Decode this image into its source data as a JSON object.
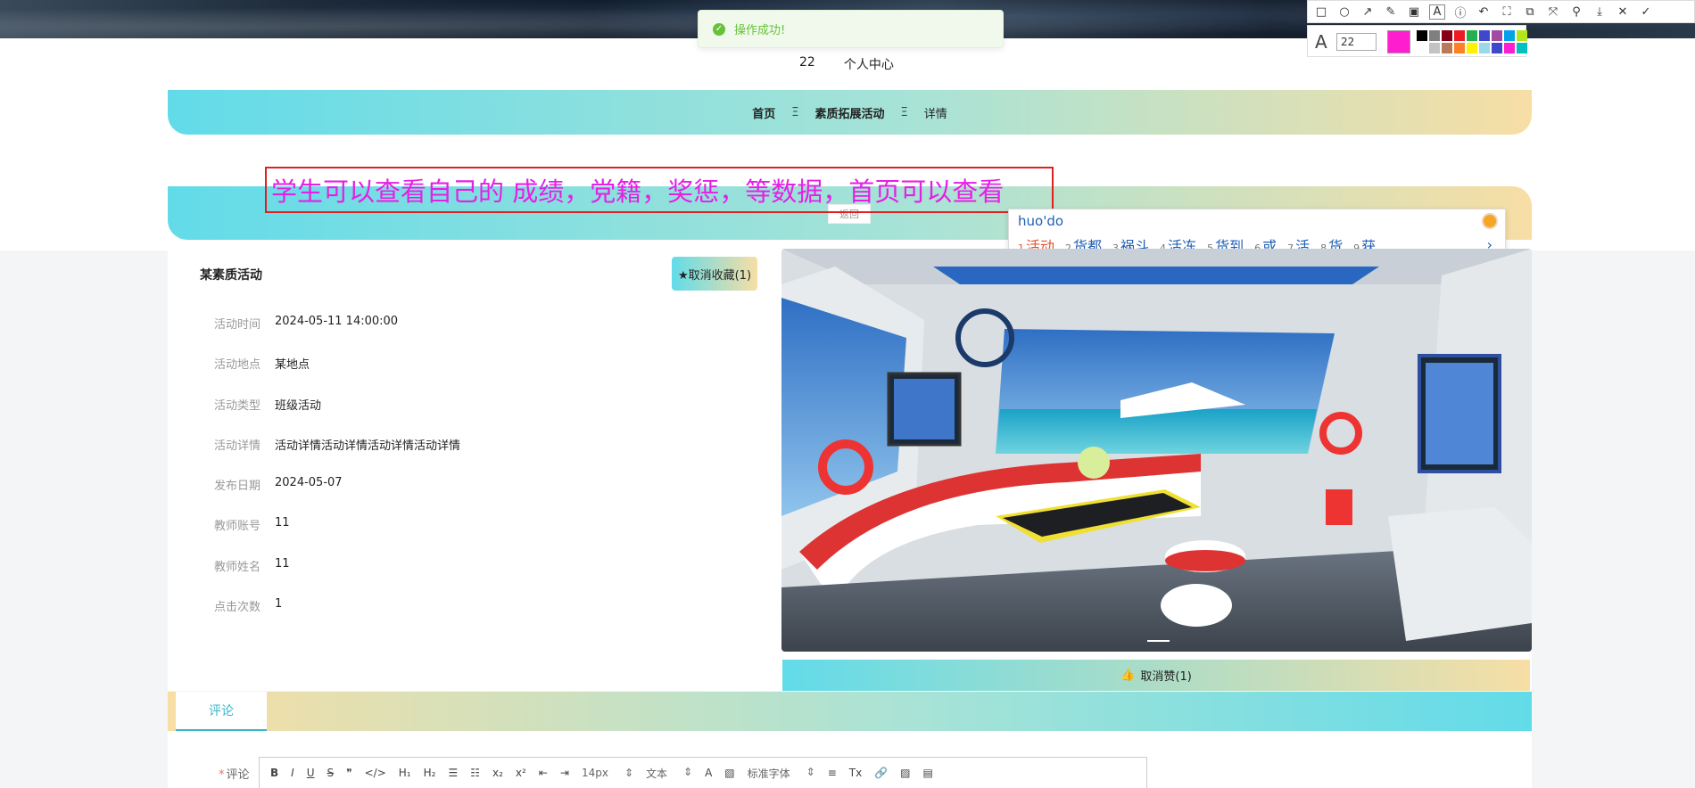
{
  "toast": {
    "message": "操作成功!"
  },
  "header": {
    "user": "22",
    "profile_link": "个人中心"
  },
  "breadcrumb": {
    "home": "首页",
    "sep": "Ξ",
    "section": "素质拓展活动",
    "current": "详情"
  },
  "back_button": {
    "label": "返回"
  },
  "annotation": {
    "text": "学生可以查看自己的 成绩，党籍，奖惩，等数据，首页可以查看"
  },
  "ime": {
    "pinyin": "huo'do",
    "candidates": [
      {
        "n": "1",
        "text": "活动"
      },
      {
        "n": "2",
        "text": "货都"
      },
      {
        "n": "3",
        "text": "祸斗"
      },
      {
        "n": "4",
        "text": "活冻"
      },
      {
        "n": "5",
        "text": "货到"
      },
      {
        "n": "6",
        "text": "或"
      },
      {
        "n": "7",
        "text": "活"
      },
      {
        "n": "8",
        "text": "货"
      },
      {
        "n": "9",
        "text": "获"
      }
    ],
    "next": "›"
  },
  "screenshot_tool": {
    "font_size": "22",
    "current_color": "#ff1dd0",
    "palette": [
      "#000000",
      "#7f7f7f",
      "#880015",
      "#ed1c24",
      "#22b14c",
      "#3f48cc",
      "#a349a4",
      "#00a2e8",
      "#b5e61d",
      "#ffffff",
      "#c3c3c3",
      "#b97a57",
      "#ff7f27",
      "#fff200",
      "#99d9ea",
      "#3f48cc",
      "#ff1dd0",
      "#00c0c0"
    ]
  },
  "activity": {
    "title": "某素质活动",
    "favorite_label": "★取消收藏(1)",
    "fields": [
      {
        "label": "活动时间",
        "value": "2024-05-11 14:00:00"
      },
      {
        "label": "活动地点",
        "value": "某地点"
      },
      {
        "label": "活动类型",
        "value": "班级活动"
      },
      {
        "label": "活动详情",
        "value": "活动详情活动详情活动详情活动详情"
      },
      {
        "label": "发布日期",
        "value": "2024-05-07"
      },
      {
        "label": "教师账号",
        "value": "11"
      },
      {
        "label": "教师姓名",
        "value": "11"
      },
      {
        "label": "点击次数",
        "value": "1"
      }
    ],
    "like_label": "取消赞(1)"
  },
  "tabs": {
    "comment": "评论"
  },
  "comment_form": {
    "label": "评论",
    "required_mark": "*",
    "font_size": "14px",
    "paragraph": "文本",
    "font_family": "标准字体"
  }
}
